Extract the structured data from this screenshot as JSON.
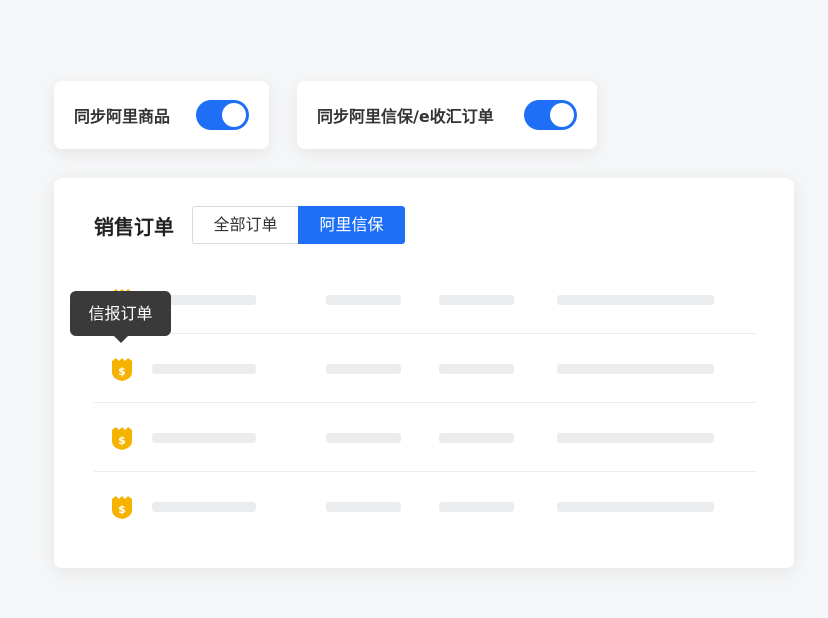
{
  "toggles": [
    {
      "label": "同步阿里商品",
      "on": true
    },
    {
      "label": "同步阿里信保/e收汇订单",
      "on": true
    }
  ],
  "orders": {
    "title": "销售订单",
    "tabs": [
      {
        "label": "全部订单",
        "active": false
      },
      {
        "label": "阿里信保",
        "active": true
      }
    ],
    "row_icon": "shield-dollar-icon",
    "row_count": 4
  },
  "tooltip": {
    "text": "信报订单"
  },
  "colors": {
    "accent": "#1f6ff6",
    "icon_gold": "#f5b300",
    "tooltip_bg": "#3a3a3a",
    "placeholder": "#ebecee"
  }
}
